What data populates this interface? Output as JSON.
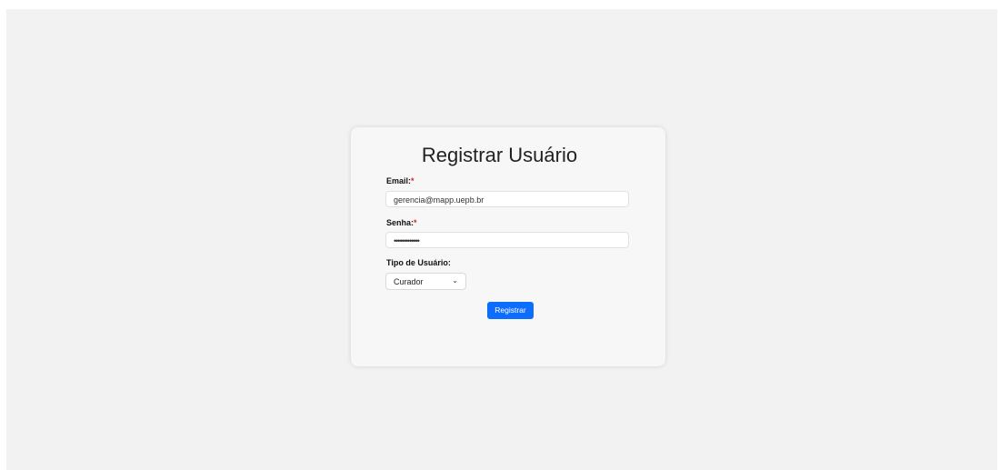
{
  "form": {
    "title": "Registrar Usuário",
    "email_label": "Email:",
    "email_required_marker": "*",
    "email_value": "gerencia@mapp.uepb.br",
    "password_label": "Senha:",
    "password_required_marker": "*",
    "password_value": "•••••••••••••",
    "user_type_label": "Tipo de Usuário:",
    "user_type_selected": "Curador",
    "submit_label": "Registrar"
  },
  "colors": {
    "page_background": "#f2f2f2",
    "card_background": "#f7f7f7",
    "primary_button": "#0d6efd",
    "required_marker": "#dd2222"
  },
  "icons": {
    "select_arrow": "chevron-down-icon"
  }
}
